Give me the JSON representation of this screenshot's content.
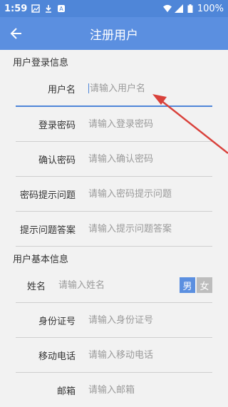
{
  "status_bar": {
    "time": "1:59",
    "battery": "100%"
  },
  "app_bar": {
    "title": "注册用户"
  },
  "sections": {
    "login": "用户登录信息",
    "basic": "用户基本信息"
  },
  "login_fields": [
    {
      "label": "用户名",
      "placeholder": "请输入用户名"
    },
    {
      "label": "登录密码",
      "placeholder": "请输入登录密码"
    },
    {
      "label": "确认密码",
      "placeholder": "请输入确认密码"
    },
    {
      "label": "密码提示问题",
      "placeholder": "请输入密码提示问题"
    },
    {
      "label": "提示问题答案",
      "placeholder": "请输入提示问题答案"
    }
  ],
  "basic_fields": [
    {
      "label": "姓名",
      "placeholder": "请输入姓名"
    },
    {
      "label": "身份证号",
      "placeholder": "请输入身份证号"
    },
    {
      "label": "移动电话",
      "placeholder": "请输入移动电话"
    },
    {
      "label": "邮箱",
      "placeholder": "请输入邮箱"
    }
  ],
  "gender": {
    "male": "男",
    "female": "女",
    "selected": "男"
  },
  "colors": {
    "primary": "#5b8fe0",
    "annotation_arrow": "#d9413b"
  }
}
